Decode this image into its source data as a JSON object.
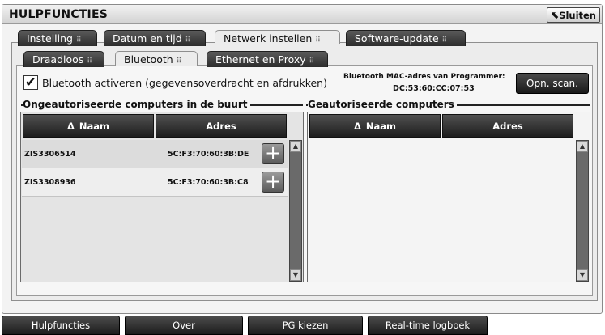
{
  "window": {
    "title": "HULPFUNCTIES",
    "close_label": "Sluiten"
  },
  "tabs_main": [
    {
      "label": "Instelling",
      "active": false
    },
    {
      "label": "Datum en tijd",
      "active": false
    },
    {
      "label": "Netwerk instellen",
      "active": true
    },
    {
      "label": "Software-update",
      "active": false
    }
  ],
  "tabs_sub": [
    {
      "label": "Draadloos",
      "active": false
    },
    {
      "label": "Bluetooth",
      "active": true
    },
    {
      "label": "Ethernet en Proxy",
      "active": false
    }
  ],
  "bluetooth": {
    "checkbox_checked": true,
    "checkbox_mark": "✔",
    "enable_label": "Bluetooth activeren (gegevensoverdracht en afdrukken)",
    "mac_title": "Bluetooth MAC-adres van Programmer:",
    "mac_value": "DC:53:60:CC:07:53",
    "scan_label": "Opn. scan."
  },
  "unauthorized": {
    "title": "Ongeautoriseerde computers in de buurt",
    "col_name": "Naam",
    "col_address": "Adres",
    "rows": [
      {
        "name": "ZIS3306514",
        "address": "5C:F3:70:60:3B:DE"
      },
      {
        "name": "ZIS3308936",
        "address": "5C:F3:70:60:3B:C8"
      }
    ]
  },
  "authorized": {
    "title": "Geautoriseerde computers",
    "col_name": "Naam",
    "col_address": "Adres",
    "rows": []
  },
  "bottom_bar": [
    {
      "label": "Hulpfuncties"
    },
    {
      "label": "Over"
    },
    {
      "label": "PG kiezen"
    },
    {
      "label": "Real-time logboek"
    }
  ],
  "icons": {
    "sort": "Δ",
    "plus": "+",
    "cursor": "⬉",
    "scroll_up": "▲",
    "scroll_down": "▼"
  }
}
